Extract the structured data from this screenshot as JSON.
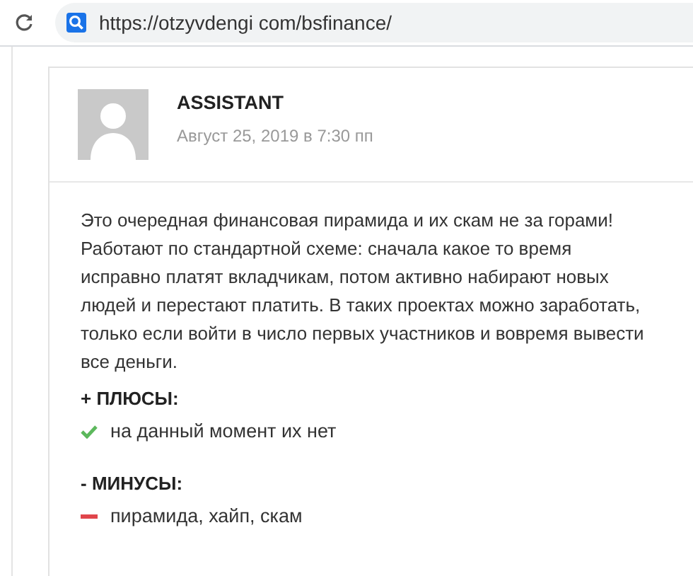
{
  "address_bar": {
    "url": "https://otzyvdengi com/bsfinance/"
  },
  "comment": {
    "author": "ASSISTANT",
    "date": "Август 25, 2019 в 7:30 пп",
    "text": "Это очередная финансовая пирамида и их скам не за горами! Работают по стандартной схеме: сначала какое то время исправно платят вкладчикам, потом активно набирают новых людей и перестают платить. В таких проектах можно заработать, только если войти в число первых участников и вовремя вывести все деньги.",
    "sections": [
      {
        "kind": "pros",
        "heading": "+ ПЛЮСЫ:",
        "items": [
          "на данный момент их нет"
        ]
      },
      {
        "kind": "cons",
        "heading": "- МИНУСЫ:",
        "items": [
          "пирамида, хайп, скам"
        ]
      }
    ]
  }
}
